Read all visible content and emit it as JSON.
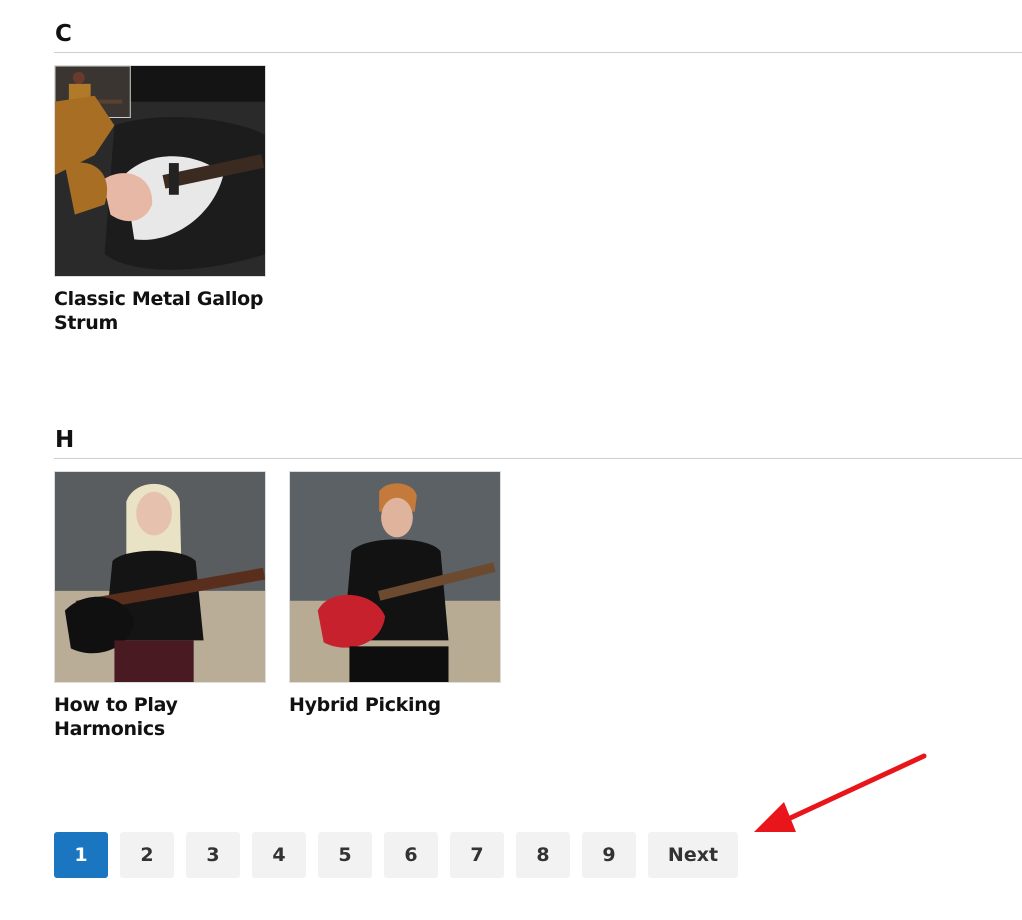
{
  "sections": [
    {
      "letter": "C",
      "cards": [
        {
          "title": "Classic Metal Gallop Strum"
        }
      ]
    },
    {
      "letter": "H",
      "cards": [
        {
          "title": "How to Play Harmonics"
        },
        {
          "title": "Hybrid Picking"
        }
      ]
    }
  ],
  "pagination": {
    "pages": [
      "1",
      "2",
      "3",
      "4",
      "5",
      "6",
      "7",
      "8",
      "9"
    ],
    "current": "1",
    "next_label": "Next"
  },
  "colors": {
    "accent": "#1a76c0",
    "button_bg": "#f2f2f2",
    "annotation_arrow": "#e8151b"
  }
}
